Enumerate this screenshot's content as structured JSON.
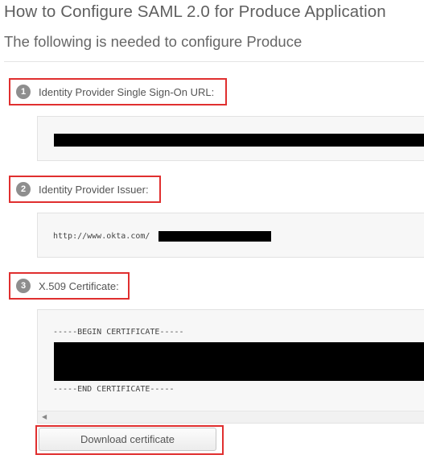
{
  "header": {
    "title": "How to Configure SAML 2.0 for Produce Application",
    "subtitle": "The following is needed to configure Produce"
  },
  "steps": [
    {
      "number": "1",
      "label": "Identity Provider Single Sign-On URL:",
      "value": ""
    },
    {
      "number": "2",
      "label": "Identity Provider Issuer:",
      "value": "http://www.okta.com/"
    },
    {
      "number": "3",
      "label": "X.509 Certificate:",
      "cert_begin": "-----BEGIN CERTIFICATE-----",
      "cert_end": "-----END CERTIFICATE-----"
    }
  ],
  "download_button": {
    "label": "Download certificate"
  },
  "icons": {
    "scroll_left": "scroll-left-arrow-icon"
  },
  "colors": {
    "highlight_outline": "#e02f2f",
    "step_badge": "#8e8e8e",
    "field_background": "#f7f7f7"
  }
}
